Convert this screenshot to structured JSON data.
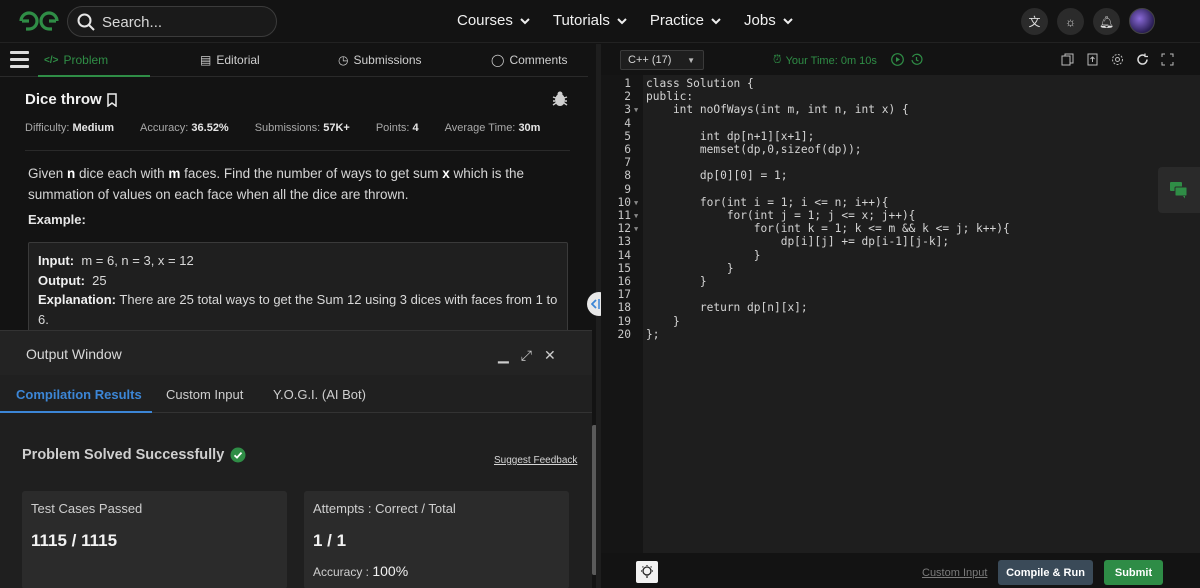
{
  "nav": {
    "search_placeholder": "Search...",
    "menu": [
      "Courses",
      "Tutorials",
      "Practice",
      "Jobs"
    ]
  },
  "tabs": {
    "problem": "Problem",
    "editorial": "Editorial",
    "submissions": "Submissions",
    "comments": "Comments"
  },
  "problem": {
    "title": "Dice throw",
    "difficulty_label": "Difficulty:",
    "difficulty": "Medium",
    "accuracy_label": "Accuracy:",
    "accuracy": "36.52%",
    "submissions_label": "Submissions:",
    "submissions": "57K+",
    "points_label": "Points:",
    "points": "4",
    "avgtime_label": "Average Time:",
    "avgtime": "30m",
    "desc_1": "Given ",
    "desc_n": "n",
    "desc_2": " dice each with ",
    "desc_m": "m",
    "desc_3": " faces. Find the number of ways to get sum ",
    "desc_x": "x",
    "desc_4": " which is the summation of values on each face when all the dice are thrown.",
    "example_label": "Example:",
    "ex_input_label": "Input:",
    "ex_input": "m = 6, n = 3, x = 12",
    "ex_output_label": "Output:",
    "ex_output": "25",
    "ex_expl_label": "Explanation:",
    "ex_expl": "There are 25 total ways to get the Sum 12 using 3 dices with faces from 1 to 6."
  },
  "output": {
    "title": "Output Window",
    "tabs": [
      "Compilation Results",
      "Custom Input",
      "Y.O.G.I. (AI Bot)"
    ],
    "status": "Problem Solved Successfully",
    "feedback": "Suggest Feedback",
    "card1_title": "Test Cases Passed",
    "card1_value": "1115 / 1115",
    "card2_title": "Attempts : Correct / Total",
    "card2_value": "1 / 1",
    "accuracy_label": "Accuracy : ",
    "accuracy_value": "100%"
  },
  "editor": {
    "language": "C++ (17)",
    "timer": "Your Time: 0m 10s",
    "line_numbers": [
      "1",
      "2",
      "3",
      "4",
      "5",
      "6",
      "7",
      "8",
      "9",
      "10",
      "11",
      "12",
      "13",
      "14",
      "15",
      "16",
      "17",
      "18",
      "19",
      "20"
    ],
    "code_lines": [
      "class Solution {",
      "public:",
      "    int noOfWays(int m, int n, int x) {",
      "",
      "        int dp[n+1][x+1];",
      "        memset(dp,0,sizeof(dp));",
      "",
      "        dp[0][0] = 1;",
      "",
      "        for(int i = 1; i <= n; i++){",
      "            for(int j = 1; j <= x; j++){",
      "                for(int k = 1; k <= m && k <= j; k++){",
      "                    dp[i][j] += dp[i-1][j-k];",
      "                }",
      "            }",
      "        }",
      "",
      "        return dp[n][x];",
      "    }",
      "};"
    ]
  },
  "bottom": {
    "custom_input": "Custom Input",
    "compile_run": "Compile & Run",
    "submit": "Submit"
  },
  "colors": {
    "brand_green": "#2f8d46",
    "blue_tab": "#3c86d6",
    "run_button": "#3a4a58",
    "submit_button": "#2e8c46"
  }
}
